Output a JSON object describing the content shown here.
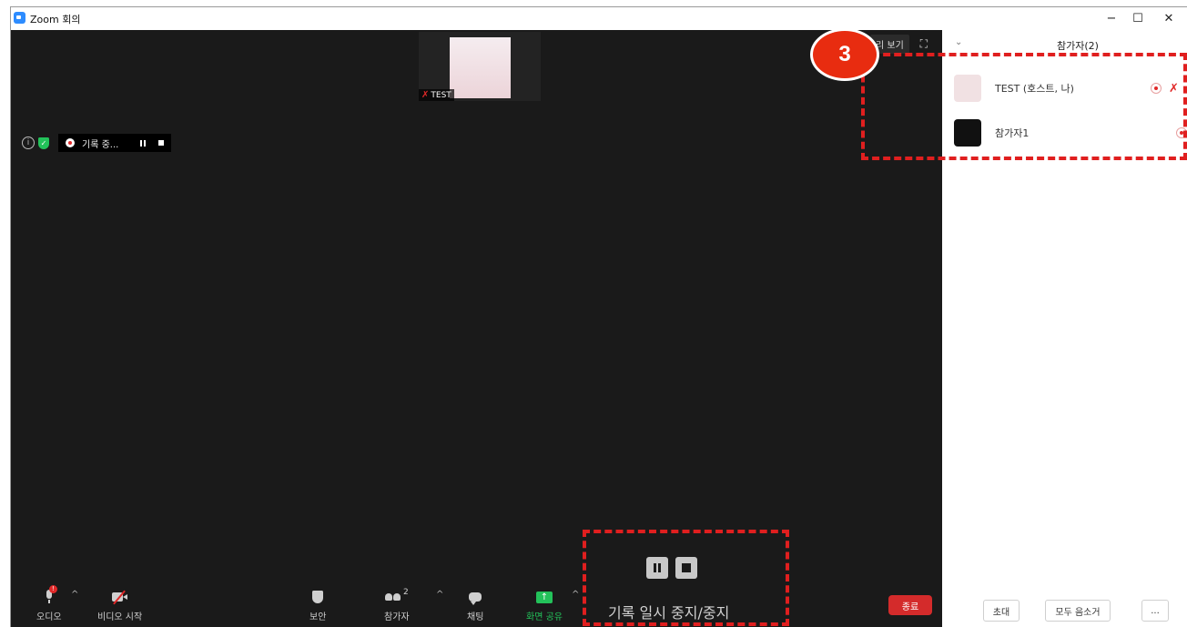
{
  "window": {
    "title": "Zoom 회의",
    "minimize": "−",
    "maximize": "☐",
    "close": "✕"
  },
  "video": {
    "thumbnail_name": "TEST",
    "view_button": "리 보기",
    "fullscreen": "⛶",
    "recording_status": "기록 중..."
  },
  "toolbar": {
    "audio_label": "오디오",
    "video_label": "비디오 시작",
    "security_label": "보안",
    "participants_label": "참가자",
    "participants_count": "2",
    "chat_label": "채팅",
    "share_label": "화면 공유",
    "caret": "^",
    "end_label": "종료"
  },
  "recording_controls": {
    "label": "기록 일시 중지/중지"
  },
  "panel": {
    "title": "참가자(2)",
    "participants": [
      {
        "name": "TEST (호스트, 나)",
        "avatar_color": "#f1e1e3"
      },
      {
        "name": "참가자1",
        "avatar_color": "#111111"
      }
    ],
    "invite_label": "초대",
    "mute_all_label": "모두 음소거",
    "more_label": "..."
  },
  "callout": {
    "number": "3",
    "color": "#e01f1f"
  }
}
